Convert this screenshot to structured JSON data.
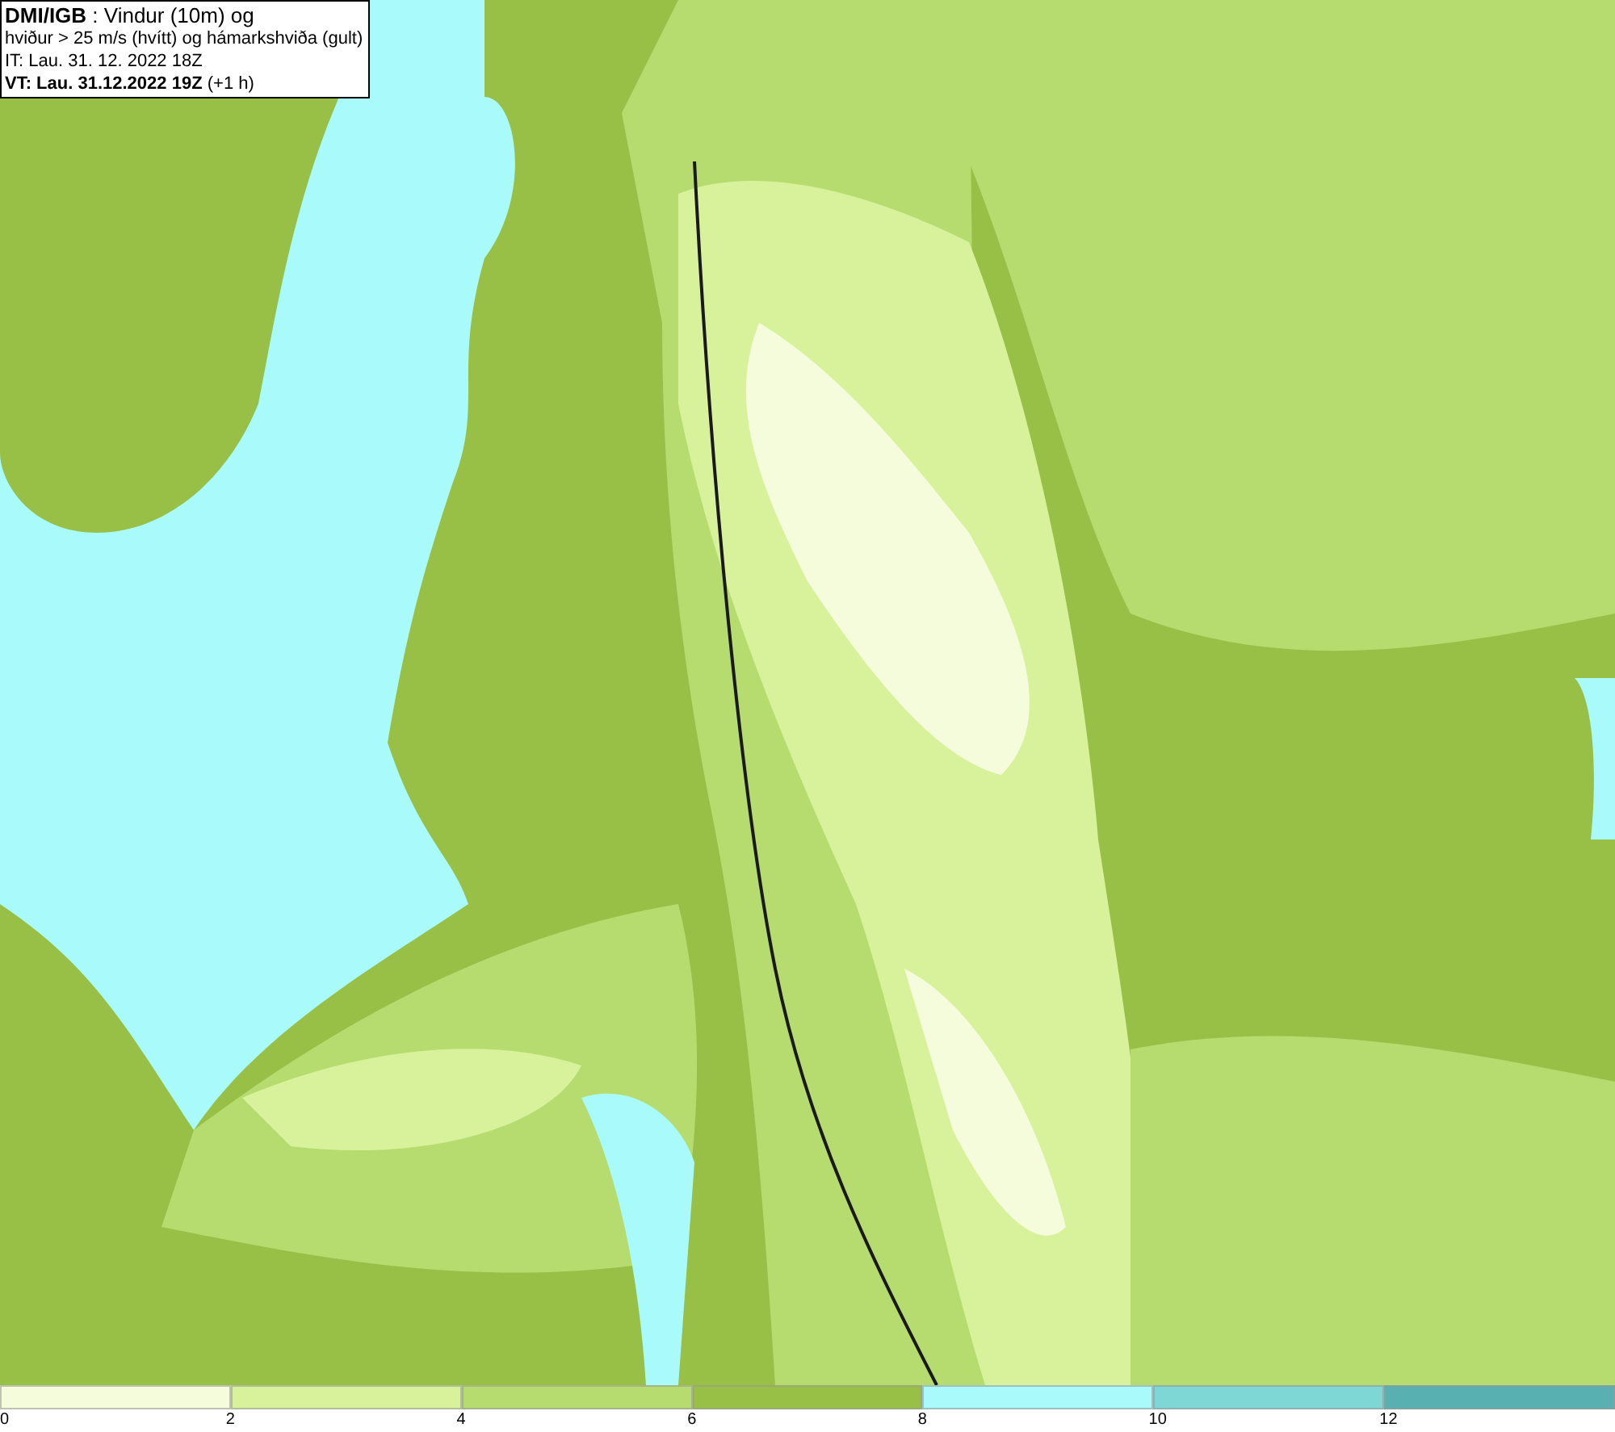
{
  "title_box": {
    "lines": [
      "**DMI/IGB** : Vindur (10m) og",
      "hviður > 25 m/s (hvítt) og hámarkshviða (gult)",
      "IT: Lau. 31. 12. 2022 18Z",
      "**VT: Lau. 31.12.2022 19Z** (+1 h)"
    ]
  },
  "legend": {
    "segments": [
      {
        "label": "0",
        "color": "#f5fcdc"
      },
      {
        "label": "2",
        "color": "#d8f29c"
      },
      {
        "label": "4",
        "color": "#b6dc70"
      },
      {
        "label": "6",
        "color": "#98c046"
      },
      {
        "label": "8",
        "color": "#a9fbfb"
      },
      {
        "label": "10",
        "color": "#7fd7d5"
      },
      {
        "label": "12",
        "color": "#58b1b0"
      }
    ]
  }
}
